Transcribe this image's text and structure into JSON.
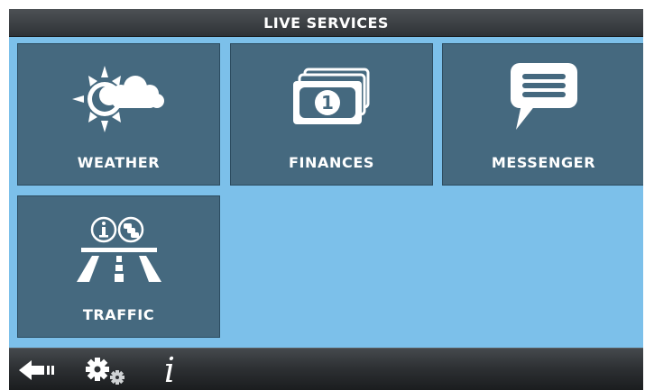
{
  "header": {
    "title": "LIVE SERVICES"
  },
  "tiles": [
    {
      "label": "WEATHER",
      "icon": "weather-icon"
    },
    {
      "label": "FINANCES",
      "icon": "banknote-icon"
    },
    {
      "label": "MESSENGER",
      "icon": "speech-bubble-icon"
    },
    {
      "label": "TRAFFIC",
      "icon": "road-info-icon"
    }
  ],
  "finances_icon_digit": "1",
  "bottom_bar": {
    "back_icon": "back-arrow-icon",
    "settings_icon": "gears-icon",
    "info_label": "i"
  },
  "colors": {
    "content_background": "#7cc0ea",
    "tile_background": "#45697f",
    "bar_background": "#2e3134",
    "text": "#ffffff"
  }
}
